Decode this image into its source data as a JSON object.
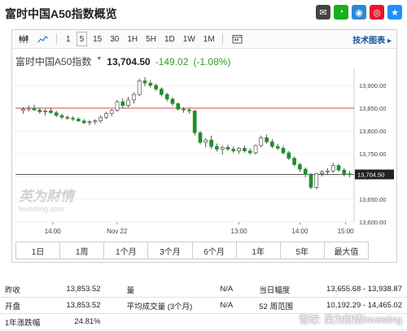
{
  "page": {
    "title": "富时中国A50指数概览"
  },
  "toolbar": {
    "intervals": [
      "1",
      "5",
      "15",
      "30",
      "1H",
      "5H",
      "1D",
      "1W",
      "1M"
    ],
    "selected_interval": "5",
    "tech_chart_label": "技术图表 ▸"
  },
  "quote": {
    "name": "富时中国A50指数",
    "price": "13,704.50",
    "change": "-149.02",
    "change_pct": "(-1.08%)"
  },
  "chart": {
    "y_ticks": [
      "13,900.00",
      "13,850.00",
      "13,800.00",
      "13,750.00",
      "13,700.00",
      "13,650.00",
      "13,600.00"
    ],
    "x_ticks": [
      "14:00",
      "Nov 22",
      "13:00",
      "14:00",
      "15:00"
    ],
    "price_tag": "13,704.50",
    "watermark_cn": "英为财情",
    "watermark_en": "Investing.com",
    "up_color": "#1a9a2a",
    "down_color": "#e00000",
    "ref_line_color": "#d44"
  },
  "chart_data": {
    "type": "candlestick",
    "ylim": [
      13600,
      13925
    ],
    "reference_line": 13850,
    "last_price_line": 13704.5,
    "x_ticks": [
      "14:00",
      "Nov 22",
      "13:00",
      "14:00",
      "15:00"
    ],
    "ohlc": [
      [
        13845,
        13852,
        13838,
        13848
      ],
      [
        13848,
        13856,
        13842,
        13850
      ],
      [
        13850,
        13858,
        13844,
        13846
      ],
      [
        13846,
        13850,
        13838,
        13842
      ],
      [
        13842,
        13848,
        13834,
        13844
      ],
      [
        13844,
        13850,
        13838,
        13840
      ],
      [
        13840,
        13844,
        13830,
        13834
      ],
      [
        13834,
        13838,
        13826,
        13830
      ],
      [
        13830,
        13834,
        13824,
        13828
      ],
      [
        13828,
        13832,
        13822,
        13826
      ],
      [
        13826,
        13830,
        13820,
        13822
      ],
      [
        13822,
        13826,
        13815,
        13818
      ],
      [
        13818,
        13824,
        13812,
        13820
      ],
      [
        13820,
        13826,
        13814,
        13822
      ],
      [
        13822,
        13834,
        13818,
        13830
      ],
      [
        13830,
        13842,
        13826,
        13838
      ],
      [
        13838,
        13848,
        13832,
        13845
      ],
      [
        13845,
        13868,
        13842,
        13864
      ],
      [
        13864,
        13872,
        13850,
        13856
      ],
      [
        13856,
        13875,
        13852,
        13868
      ],
      [
        13868,
        13885,
        13860,
        13880
      ],
      [
        13880,
        13915,
        13876,
        13910
      ],
      [
        13910,
        13918,
        13898,
        13905
      ],
      [
        13905,
        13912,
        13895,
        13900
      ],
      [
        13900,
        13904,
        13888,
        13892
      ],
      [
        13892,
        13896,
        13876,
        13880
      ],
      [
        13880,
        13884,
        13865,
        13870
      ],
      [
        13870,
        13874,
        13855,
        13860
      ],
      [
        13860,
        13862,
        13845,
        13848
      ],
      [
        13848,
        13852,
        13840,
        13846
      ],
      [
        13846,
        13850,
        13838,
        13844
      ],
      [
        13844,
        13846,
        13790,
        13796
      ],
      [
        13796,
        13800,
        13770,
        13775
      ],
      [
        13775,
        13784,
        13764,
        13780
      ],
      [
        13780,
        13790,
        13760,
        13766
      ],
      [
        13766,
        13772,
        13755,
        13760
      ],
      [
        13760,
        13768,
        13748,
        13764
      ],
      [
        13764,
        13770,
        13756,
        13760
      ],
      [
        13760,
        13766,
        13752,
        13756
      ],
      [
        13756,
        13764,
        13750,
        13762
      ],
      [
        13762,
        13768,
        13752,
        13756
      ],
      [
        13756,
        13762,
        13748,
        13752
      ],
      [
        13752,
        13770,
        13748,
        13768
      ],
      [
        13768,
        13790,
        13764,
        13785
      ],
      [
        13785,
        13792,
        13772,
        13776
      ],
      [
        13776,
        13782,
        13762,
        13766
      ],
      [
        13766,
        13772,
        13758,
        13762
      ],
      [
        13762,
        13768,
        13748,
        13752
      ],
      [
        13752,
        13756,
        13736,
        13740
      ],
      [
        13740,
        13744,
        13722,
        13726
      ],
      [
        13726,
        13730,
        13710,
        13716
      ],
      [
        13716,
        13720,
        13698,
        13704
      ],
      [
        13704,
        13708,
        13672,
        13676
      ],
      [
        13676,
        13708,
        13672,
        13706
      ],
      [
        13706,
        13714,
        13700,
        13710
      ],
      [
        13710,
        13718,
        13704,
        13712
      ],
      [
        13712,
        13730,
        13708,
        13724
      ],
      [
        13724,
        13728,
        13710,
        13714
      ],
      [
        13714,
        13718,
        13700,
        13706
      ],
      [
        13706,
        13712,
        13698,
        13704
      ]
    ]
  },
  "ranges": [
    "1日",
    "1周",
    "1个月",
    "3个月",
    "6个月",
    "1年",
    "5年",
    "最大值"
  ],
  "stats": [
    {
      "l1": "昨收",
      "v1": "13,853.52",
      "l2": "量",
      "v2": "N/A",
      "l3": "当日幅度",
      "v3": "13,655.68 - 13,938.87"
    },
    {
      "l1": "开盘",
      "v1": "13,853.52",
      "l2": "平均成交量 (3个月)",
      "v2": "N/A",
      "l3": "52 周范围",
      "v3": "10,192.29 - 14,465.02"
    },
    {
      "l1": "1年涨跌幅",
      "v1": "24.81%",
      "l2": "",
      "v2": "",
      "l3": "",
      "v3": ""
    }
  ],
  "footer": {
    "watermark": "雪球: 英为财情Investing"
  }
}
